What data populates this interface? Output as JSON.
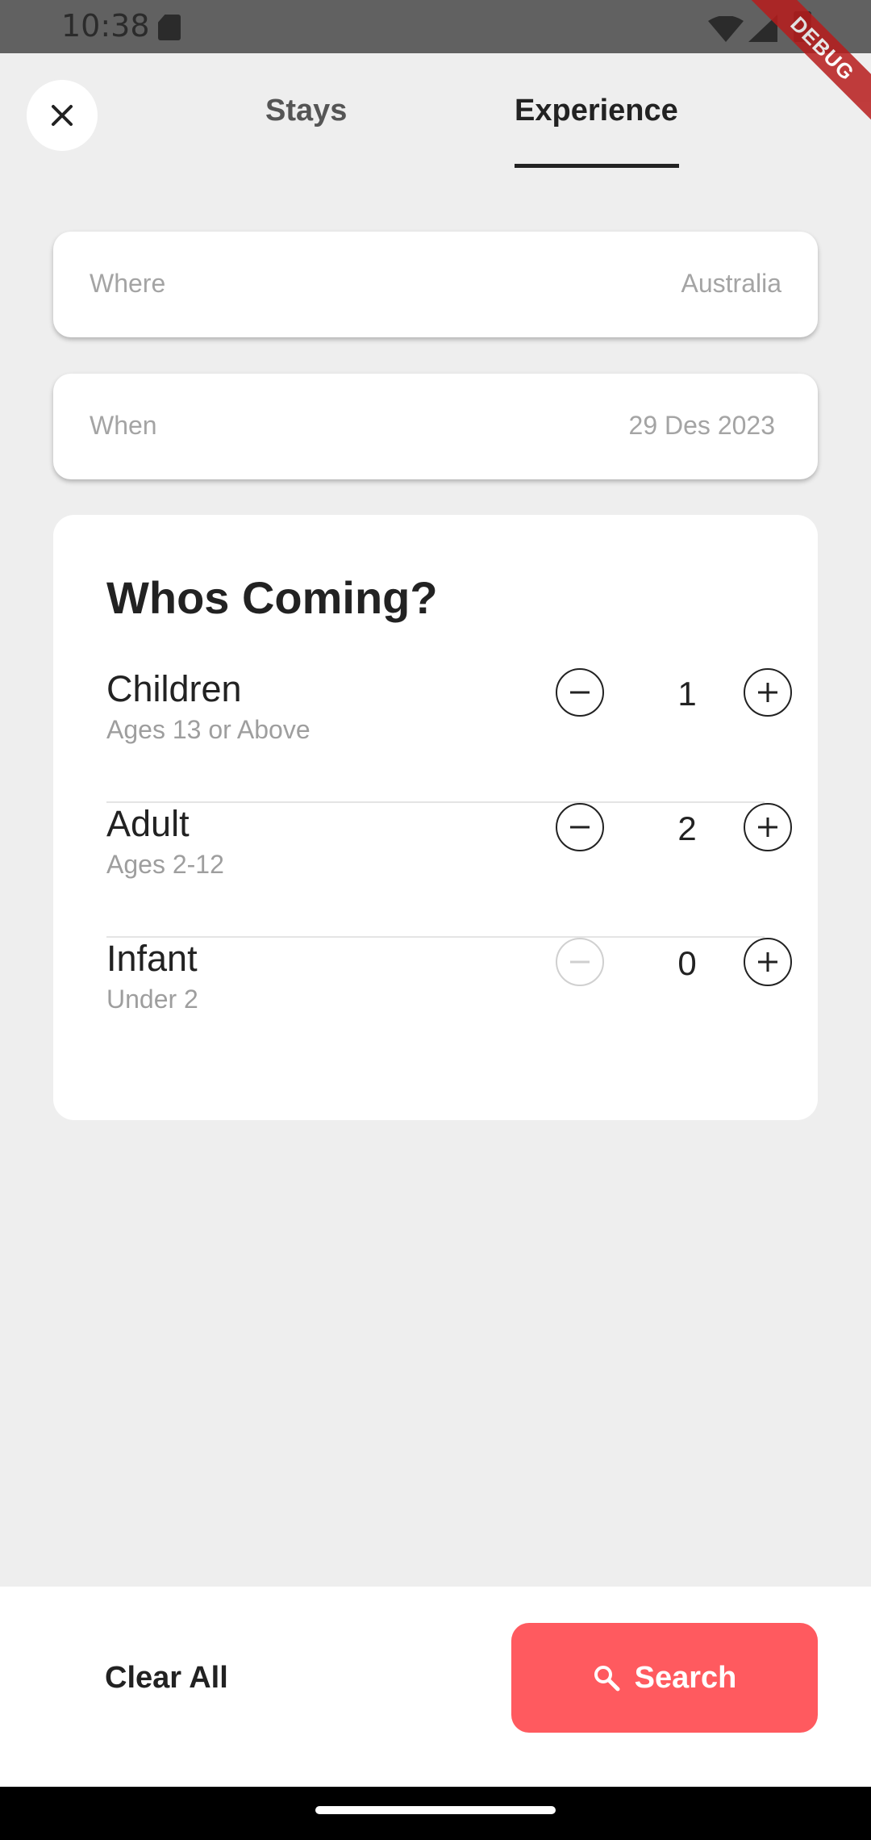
{
  "status_bar": {
    "time": "10:38",
    "debug_label": "DEBUG"
  },
  "header": {
    "close_icon": "close-icon",
    "tabs": [
      {
        "label": "Stays",
        "active": false
      },
      {
        "label": "Experience",
        "active": true
      }
    ]
  },
  "where": {
    "label": "Where",
    "value": "Australia"
  },
  "when": {
    "label": "When",
    "value": "29 Des 2023"
  },
  "guests": {
    "title": "Whos Coming?",
    "rows": [
      {
        "name": "Children",
        "description": "Ages 13 or Above",
        "count": "1",
        "minus_enabled": true
      },
      {
        "name": "Adult",
        "description": "Ages 2-12",
        "count": "2",
        "minus_enabled": true
      },
      {
        "name": "Infant",
        "description": "Under 2",
        "count": "0",
        "minus_enabled": false
      }
    ]
  },
  "footer": {
    "clear_label": "Clear All",
    "search_label": "Search",
    "search_icon": "search-icon"
  },
  "colors": {
    "accent": "#ff5a5f",
    "background": "#eeeeee",
    "card": "#ffffff",
    "text": "#222222",
    "muted": "#a4a4a4"
  }
}
